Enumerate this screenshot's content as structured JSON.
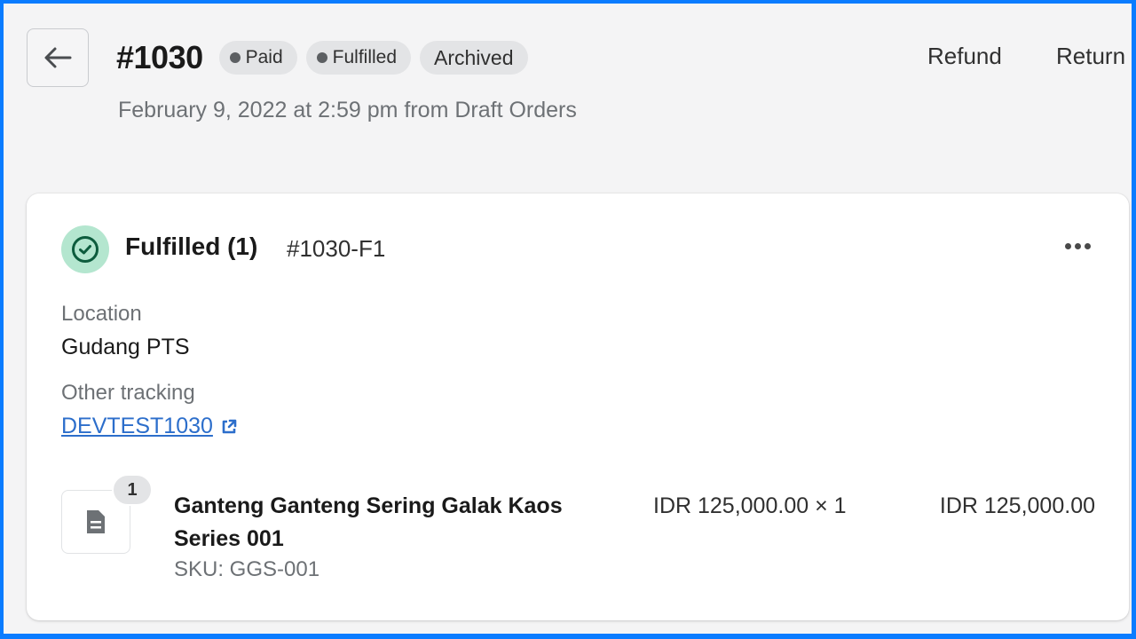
{
  "header": {
    "back_button_label": "Back",
    "order_number": "#1030",
    "badges": [
      {
        "label": "Paid",
        "has_dot": true
      },
      {
        "label": "Fulfilled",
        "has_dot": true
      },
      {
        "label": "Archived",
        "has_dot": false
      }
    ],
    "subtitle": "February 9, 2022 at 2:59 pm from Draft Orders",
    "actions": {
      "refund": "Refund",
      "return": "Return"
    }
  },
  "fulfillment": {
    "status_title": "Fulfilled (1)",
    "fulfillment_id": "#1030-F1",
    "more_actions_icon": "ellipsis-horizontal-icon",
    "location_label": "Location",
    "location_value": "Gudang PTS",
    "tracking_label": "Other tracking",
    "tracking_number": "DEVTEST1030",
    "line_items": [
      {
        "quantity_badge": "1",
        "name": "Ganteng Ganteng Sering Galak Kaos Series 001",
        "sku": "SKU: GGS-001",
        "unit_price": "IDR 125,000.00 × 1",
        "total": "IDR 125,000.00",
        "thumbnail_icon": "document-placeholder-icon"
      }
    ]
  },
  "colors": {
    "accent_link": "#2c6ecb",
    "fulfilled_icon_bg": "#b4e6cf",
    "fulfilled_icon_fg": "#0d5c3d",
    "badge_bg": "#e3e4e6",
    "page_bg": "#f4f4f5",
    "frame_border": "#0a7cff"
  }
}
